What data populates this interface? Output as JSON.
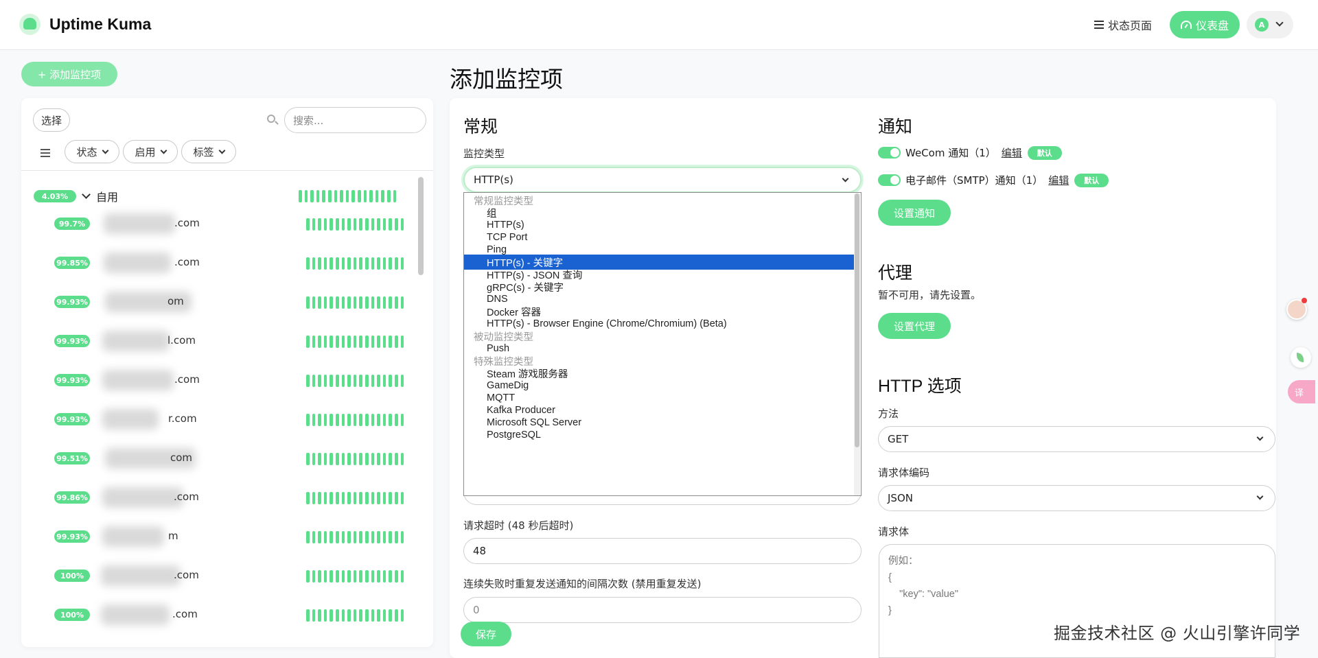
{
  "header": {
    "app_title": "Uptime Kuma",
    "status_page_label": "状态页面",
    "dashboard_label": "仪表盘",
    "avatar_letter": "A",
    "icons": [
      "logo-icon",
      "menu-icon",
      "dashboard-gauge-icon",
      "chevron-down-icon"
    ]
  },
  "sidebar": {
    "add_monitor_label": "+ 添加监控项",
    "select_label": "选择",
    "search_placeholder": "搜索...",
    "filters": {
      "status": "状态",
      "active": "启用",
      "tags": "标签"
    },
    "group": {
      "badge": "4.03%",
      "name": "自用"
    },
    "monitors": [
      {
        "badge": "99.7%",
        "name": ".com"
      },
      {
        "badge": "99.85%",
        "name": ".com"
      },
      {
        "badge": "99.93%",
        "name": "om"
      },
      {
        "badge": "99.93%",
        "name": "l.com"
      },
      {
        "badge": "99.93%",
        "name": ".com"
      },
      {
        "badge": "99.93%",
        "name": "r.com"
      },
      {
        "badge": "99.51%",
        "name": "com"
      },
      {
        "badge": "99.86%",
        "name": ".com"
      },
      {
        "badge": "99.93%",
        "name": "m"
      },
      {
        "badge": "100%",
        "name": ".com"
      },
      {
        "badge": "100%",
        "name": ".com"
      }
    ]
  },
  "main": {
    "page_title": "添加监控项",
    "general": {
      "heading": "常规",
      "monitor_type_label": "监控类型",
      "monitor_type_value": "HTTP(s)",
      "timeout_label": "请求超时 (48 秒后超时)",
      "timeout_value": "48",
      "resend_label": "连续失败时重复发送通知的间隔次数 (禁用重复发送)",
      "resend_value": "0",
      "save_label": "保存"
    },
    "monitor_type_options": [
      {
        "label": "常规监控类型",
        "group": true
      },
      {
        "label": "组"
      },
      {
        "label": "HTTP(s)"
      },
      {
        "label": "TCP Port"
      },
      {
        "label": "Ping"
      },
      {
        "label": "HTTP(s) - 关键字",
        "selected": true
      },
      {
        "label": "HTTP(s) - JSON 查询"
      },
      {
        "label": "gRPC(s) - 关键字"
      },
      {
        "label": "DNS"
      },
      {
        "label": "Docker 容器"
      },
      {
        "label": "HTTP(s) - Browser Engine (Chrome/Chromium) (Beta)"
      },
      {
        "label": "被动监控类型",
        "group": true
      },
      {
        "label": "Push"
      },
      {
        "label": "特殊监控类型",
        "group": true
      },
      {
        "label": "Steam 游戏服务器"
      },
      {
        "label": "GameDig"
      },
      {
        "label": "MQTT"
      },
      {
        "label": "Kafka Producer"
      },
      {
        "label": "Microsoft SQL Server"
      },
      {
        "label": "PostgreSQL"
      }
    ],
    "notifications": {
      "heading": "通知",
      "items": [
        {
          "name": "WeCom 通知（1）",
          "edit": "编辑",
          "default": "默认"
        },
        {
          "name": "电子邮件（SMTP）通知（1）",
          "edit": "编辑",
          "default": "默认"
        }
      ],
      "setup_label": "设置通知"
    },
    "proxy": {
      "heading": "代理",
      "unavailable_text": "暂不可用，请先设置。",
      "setup_label": "设置代理"
    },
    "http_options": {
      "heading": "HTTP 选项",
      "method_label": "方法",
      "method_value": "GET",
      "body_encoding_label": "请求体编码",
      "body_encoding_value": "JSON",
      "body_label": "请求体",
      "body_placeholder": "例如：\n{\n    \"key\": \"value\"\n}"
    }
  },
  "floating": {
    "translate_label": "译"
  },
  "watermark": "掘金技术社区 @ 火山引擎许同学",
  "colors": {
    "accent": "#5cdd8b",
    "selected_option": "#1a62d1"
  }
}
